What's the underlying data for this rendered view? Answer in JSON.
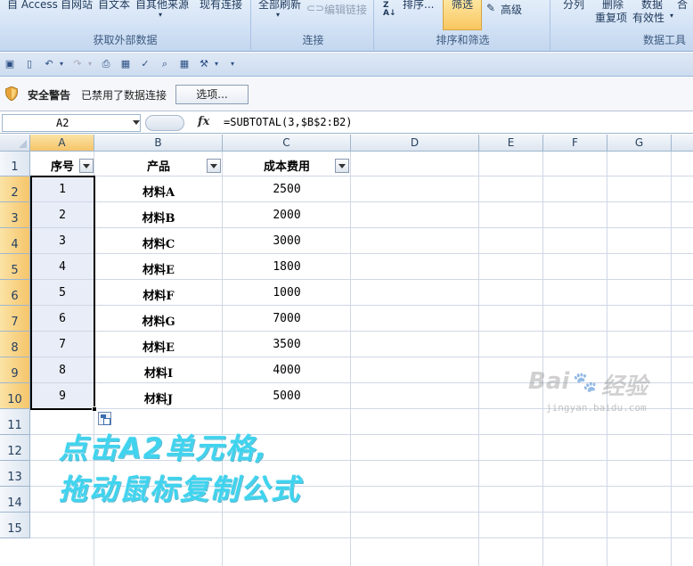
{
  "ribbon": {
    "groups": [
      {
        "title": "获取外部数据",
        "items": [
          "自 Access",
          "自网站",
          "自文本",
          "自其他来源",
          "现有连接"
        ]
      },
      {
        "title": "连接",
        "items": [
          "全部刷新",
          "编辑链接"
        ]
      },
      {
        "title": "排序和筛选",
        "items": [
          "排序...",
          "筛选",
          "高级"
        ]
      },
      {
        "title": "数据工具",
        "items": [
          "分列",
          "删除",
          "重复项",
          "数据",
          "有效性",
          "合"
        ]
      }
    ]
  },
  "security": {
    "title": "安全警告",
    "message": "已禁用了数据连接",
    "button": "选项..."
  },
  "formula_bar": {
    "name_box": "A2",
    "fx": "fx",
    "formula": "=SUBTOTAL(3,$B$2:B2)"
  },
  "columns": [
    "A",
    "B",
    "C",
    "D",
    "E",
    "F",
    "G"
  ],
  "rows": [
    "1",
    "2",
    "3",
    "4",
    "5",
    "6",
    "7",
    "8",
    "9",
    "10",
    "11",
    "12",
    "13",
    "14",
    "15"
  ],
  "table": {
    "headers": [
      "序号",
      "产品",
      "成本费用"
    ],
    "data": [
      [
        "1",
        "材料A",
        "2500"
      ],
      [
        "2",
        "材料B",
        "2000"
      ],
      [
        "3",
        "材料C",
        "3000"
      ],
      [
        "4",
        "材料E",
        "1800"
      ],
      [
        "5",
        "材料F",
        "1000"
      ],
      [
        "6",
        "材料G",
        "7000"
      ],
      [
        "7",
        "材料E",
        "3500"
      ],
      [
        "8",
        "材料I",
        "4000"
      ],
      [
        "9",
        "材料J",
        "5000"
      ]
    ]
  },
  "annotation": {
    "line1": "点击A2单元格,",
    "line2": "拖动鼠标复制公式"
  },
  "watermark": {
    "brand": "Bai",
    "brand2": "经验",
    "url": "jingyan.baidu.com"
  }
}
